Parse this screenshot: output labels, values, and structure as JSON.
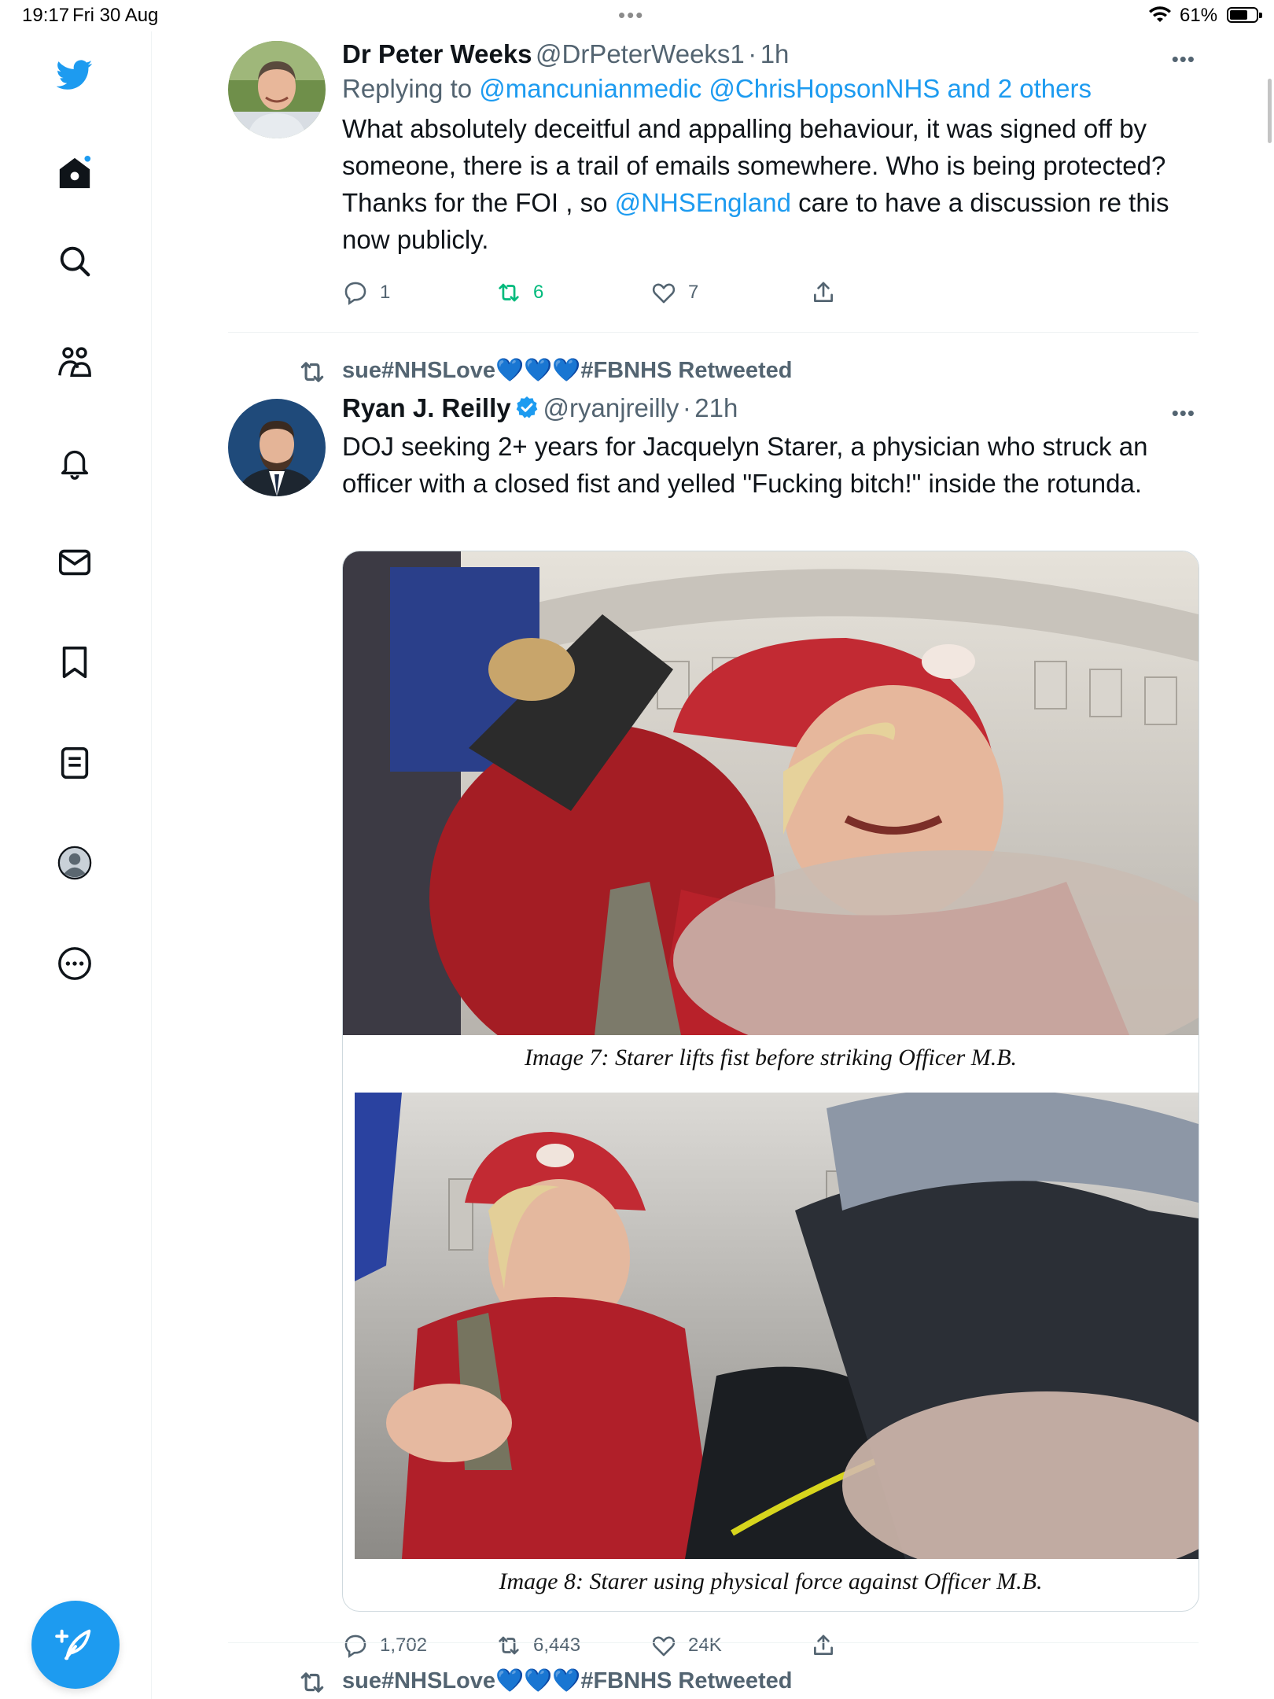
{
  "status_bar": {
    "time": "19:17",
    "date": "Fri 30 Aug",
    "battery": "61%",
    "battery_level": 0.61
  },
  "sidebar": {
    "items": [
      "home",
      "explore",
      "communities",
      "notifications",
      "messages",
      "bookmarks",
      "lists",
      "profile",
      "more"
    ]
  },
  "tweets": [
    {
      "name": "Dr Peter Weeks",
      "handle": "@DrPeterWeeks1",
      "sep": "·",
      "time": "1h",
      "replying_prefix": "Replying to ",
      "replying_mentions": "@mancunianmedic @ChrisHopsonNHS",
      "replying_and": " and 2 others",
      "text_part1": "What absolutely deceitful and appalling behaviour, it was signed off by someone, there is a trail of emails somewhere. Who is being protected? Thanks for the FOI , so ",
      "text_mention": "@NHSEngland",
      "text_part2": " care to have a discussion re this now publicly.",
      "replies": "1",
      "retweets": "6",
      "likes": "7"
    },
    {
      "retweeted_by": "sue#NHSLove💙💙💙#FBNHS Retweeted",
      "name": "Ryan J. Reilly",
      "handle": "@ryanjreilly",
      "sep": "·",
      "time": "21h",
      "text": "DOJ seeking 2+ years for Jacquelyn Starer, a physician who struck an officer with a closed fist and yelled \"Fucking bitch!\" inside the rotunda.",
      "image_caption_1": "Image 7: Starer lifts fist before striking Officer M.B.",
      "image_caption_2": "Image 8: Starer using physical force against Officer M.B.",
      "replies": "1,702",
      "retweets": "6,443",
      "likes": "24K"
    },
    {
      "retweeted_by": "sue#NHSLove💙💙💙#FBNHS Retweeted"
    }
  ],
  "colors": {
    "accent": "#1d9bf0",
    "retweet_green": "#00ba7c",
    "secondary_text": "#536471"
  }
}
